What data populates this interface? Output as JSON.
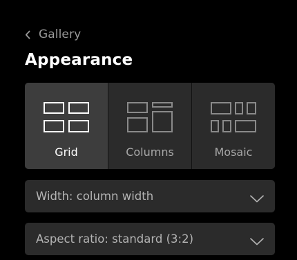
{
  "nav": {
    "back_label": "Gallery",
    "back_icon": "chevron-left-icon"
  },
  "page": {
    "title": "Appearance"
  },
  "layout_options": [
    {
      "label": "Grid",
      "icon": "grid-layout-icon",
      "selected": true
    },
    {
      "label": "Columns",
      "icon": "columns-layout-icon",
      "selected": false
    },
    {
      "label": "Mosaic",
      "icon": "mosaic-layout-icon",
      "selected": false
    }
  ],
  "width_select": {
    "value": "Width: column width",
    "icon": "chevron-down-icon"
  },
  "aspect_select": {
    "value": "Aspect ratio: standard (3:2)",
    "icon": "chevron-down-icon"
  },
  "colors": {
    "background": "#000000",
    "control": "#2b2b2b",
    "selected": "#3d3d3d",
    "muted_text": "#9a9a9a"
  }
}
